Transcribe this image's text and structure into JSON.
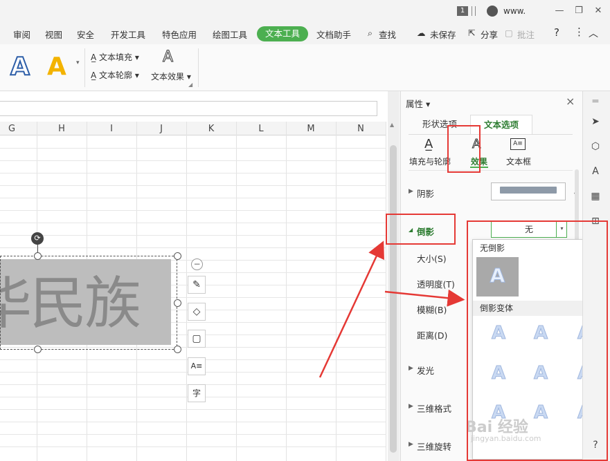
{
  "titlebar": {
    "badge": "1",
    "username": "www.",
    "minimize": "—",
    "restore": "❐",
    "close": "✕"
  },
  "menu": [
    "审阅",
    "视图",
    "安全",
    "开发工具",
    "特色应用",
    "绘图工具",
    "文本工具",
    "文档助手",
    "查找",
    "未保存",
    "分享",
    "批注"
  ],
  "menu_active": "文本工具",
  "ribbon": {
    "text_fill": "文本填充",
    "text_outline": "文本轮廓",
    "text_effect": "文本效果",
    "sample_a": "A"
  },
  "sheet": {
    "columns": [
      "G",
      "H",
      "I",
      "J",
      "K",
      "L",
      "M",
      "N"
    ],
    "wordart_text": "华民族"
  },
  "panel": {
    "title": "属性",
    "close": "×",
    "tabs": [
      "形状选项",
      "文本选项"
    ],
    "active_tab": "文本选项",
    "subtabs": [
      "填充与轮廓",
      "效果",
      "文本框"
    ],
    "active_subtab": "效果",
    "shadow": "阴影",
    "reflection": "倒影",
    "reflection_value": "无",
    "size": "大小(S)",
    "transparency": "透明度(T)",
    "blur": "模糊(B)",
    "distance": "距离(D)",
    "glow": "发光",
    "format3d": "三维格式",
    "rotate3d": "三维旋转"
  },
  "popup": {
    "no_reflection": "无倒影",
    "variants": "倒影变体",
    "preview_a": "A"
  },
  "watermark": {
    "logo": "Bai 经验",
    "url": "jingyan.baidu.com"
  },
  "colors": {
    "accent": "#4caf50",
    "annotation": "#e53935"
  }
}
